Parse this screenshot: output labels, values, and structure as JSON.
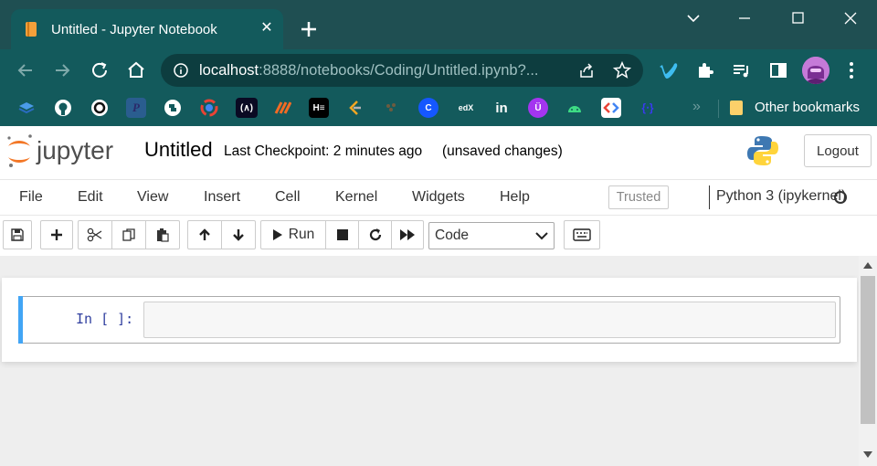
{
  "browser": {
    "tab_title": "Untitled - Jupyter Notebook",
    "url_host": "localhost",
    "url_rest": ":8888/notebooks/Coding/Untitled.ipynb?...",
    "bookmarks_overflow": "»",
    "other_bookmarks_label": "Other bookmarks",
    "bookmark_icons": [
      "layers-icon",
      "github-icon",
      "codewars-icon",
      "python-p-icon",
      "python-icon",
      "gdg-icon",
      "freecodecamp-icon",
      "codeforces-icon",
      "hackerearth-icon",
      "leetcode-icon",
      "codechef-icon",
      "codecademy-icon",
      "edx-icon",
      "linkedin-icon",
      "udemy-icon",
      "android-icon",
      "google-dev-icon",
      "json-icon"
    ],
    "bookmark_glyphs": {
      "freecodecamp": "(∧)",
      "hackerearth": "H≡",
      "codecademy": "C",
      "edx": "edX",
      "linkedin": "in",
      "udemy": "Ü",
      "json": "{⋅}"
    },
    "accent_color": "#135a5c"
  },
  "jupyter": {
    "logo_text": "jupyter",
    "notebook_name": "Untitled",
    "checkpoint": "Last Checkpoint: 2 minutes ago",
    "unsaved": "(unsaved changes)",
    "logout_label": "Logout",
    "menu": [
      "File",
      "Edit",
      "View",
      "Insert",
      "Cell",
      "Kernel",
      "Widgets",
      "Help"
    ],
    "trusted_label": "Trusted",
    "kernel_name": "Python 3 (ipykernel)",
    "toolbar": {
      "run_label": "Run",
      "cell_type": "Code"
    },
    "cell": {
      "prompt": "In [ ]:",
      "code": ""
    }
  }
}
